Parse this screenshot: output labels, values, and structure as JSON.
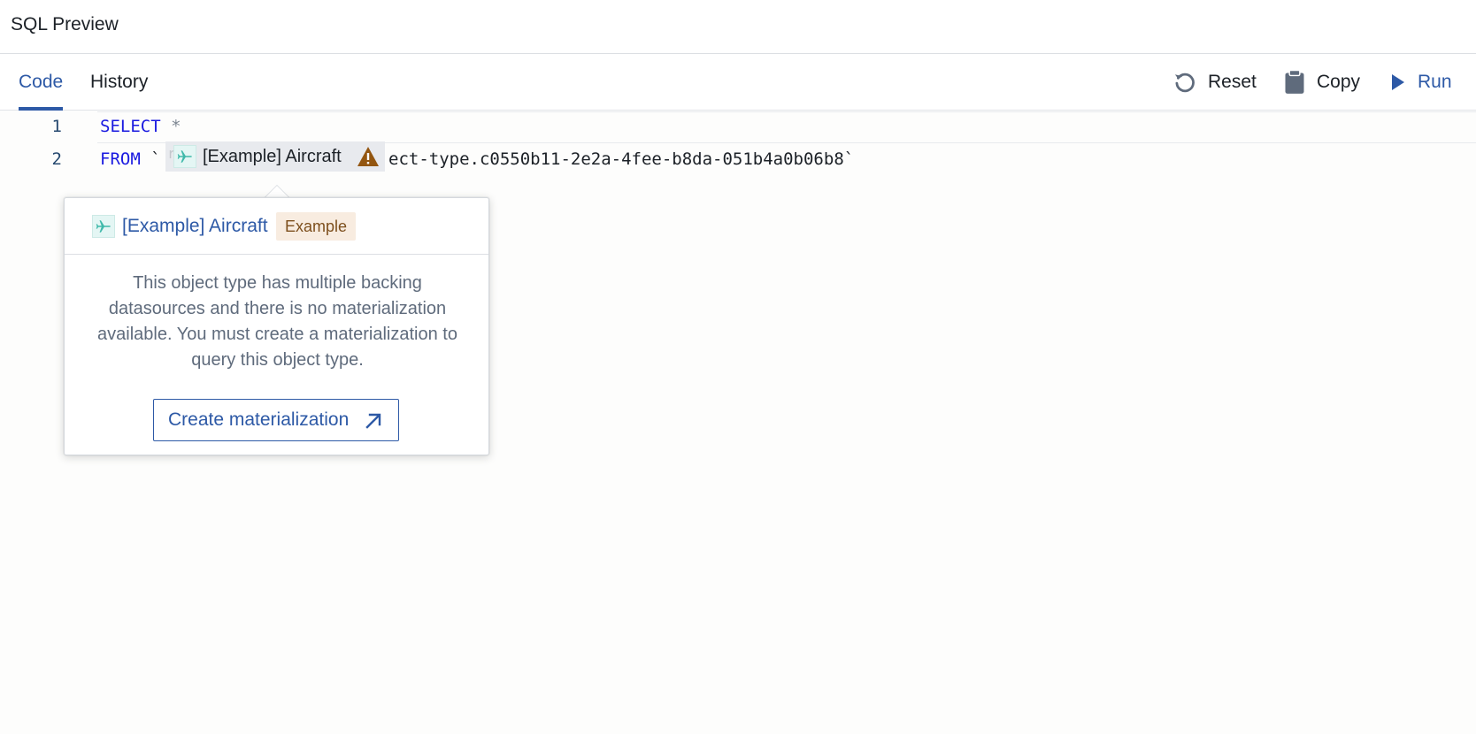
{
  "window": {
    "title": "SQL Preview"
  },
  "tabs": [
    {
      "label": "Code",
      "active": true
    },
    {
      "label": "History",
      "active": false
    }
  ],
  "actions": {
    "reset_label": "Reset",
    "copy_label": "Copy",
    "run_label": "Run",
    "icons": [
      "reset-icon",
      "clipboard-icon",
      "play-icon"
    ]
  },
  "editor": {
    "lines": [
      {
        "number": "1",
        "keyword": "SELECT",
        "rest": "*"
      },
      {
        "number": "2",
        "keyword": "FROM",
        "open_quote": "`",
        "hidden_fragment": "r",
        "trailing": "ect-type.c0550b11-2e2a-4fee-b8da-051b4a0b06b8`"
      }
    ],
    "object_chip": {
      "label": "[Example] Aircraft",
      "icon": "airplane-icon",
      "status_icon": "warning-icon"
    }
  },
  "popover": {
    "object_name": "[Example] Aircraft",
    "tag": "Example",
    "message": "This object type has multiple backing datasources and there is no materialization available. You must create a materialization to query this object type.",
    "button_label": "Create materialization",
    "button_icon": "arrow-up-right-icon"
  },
  "colors": {
    "accent": "#2d59a6",
    "keyword": "#1a1ae0",
    "warning": "#935610",
    "tag_background": "#f8ece0",
    "object_icon": "#3fb9aa"
  }
}
